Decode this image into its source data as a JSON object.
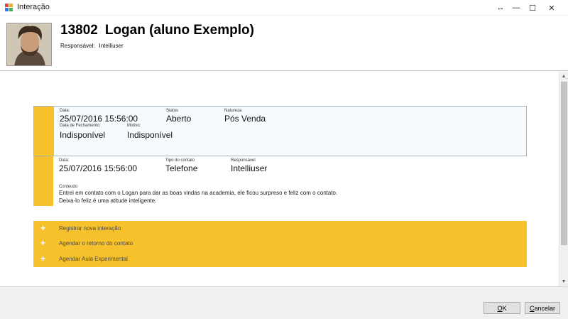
{
  "window": {
    "title": "Interação",
    "controls": {
      "resize": "↔",
      "minimize": "—",
      "maximize": "☐",
      "close": "✕"
    }
  },
  "header": {
    "student_id": "13802",
    "student_name": "Logan (aluno Exemplo)",
    "responsavel_label": "Responsável:",
    "responsavel_value": "Intelliuser"
  },
  "interaction": {
    "data_label": "Data:",
    "data_value": "25/07/2016 15:56:00",
    "status_label": "Status",
    "status_value": "Aberto",
    "natureza_label": "Natureza",
    "natureza_value": "Pós Venda",
    "fechamento_label": "Data de Fechamento:",
    "fechamento_value": "Indisponível",
    "motivo_label": "Motivo:",
    "motivo_value": "Indisponível"
  },
  "contact": {
    "data_label": "Data:",
    "data_value": "25/07/2016 15:56:00",
    "tipo_label": "Tipo do contato",
    "tipo_value": "Telefone",
    "responsavel_label": "Responsável",
    "responsavel_value": "Intelliuser",
    "conteudo_label": "Conteudo",
    "conteudo_line1": "Entrei em contato com o Logan para dar as boas vindas na academia, ele ficou surpreso e feliz com o contato.",
    "conteudo_line2": "Deixa-lo feliz é uma atitude inteligente."
  },
  "actions": [
    {
      "label": "Registrar nova interação"
    },
    {
      "label": "Agendar o retorno do contato"
    },
    {
      "label": "Agendar Aula Experimental"
    }
  ],
  "buttons": {
    "ok": "OK",
    "cancel": "Cancelar"
  },
  "colors": {
    "accent": "#f6c12a",
    "card_border": "#a7b2bb"
  }
}
